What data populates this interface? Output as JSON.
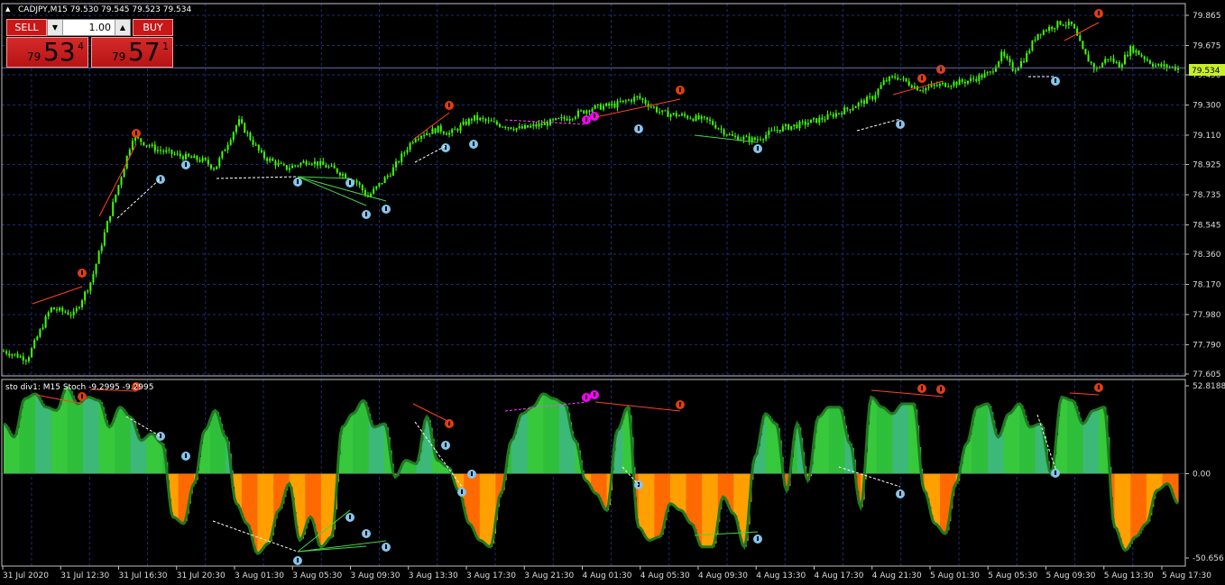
{
  "main_header": "CADJPY,M15  79.530 79.545 79.523 79.534",
  "sub_header": "sto div1: M15 Stoch -9.2995 -9.2995",
  "trade_panel": {
    "sell_label": "SELL",
    "buy_label": "BUY",
    "lot": "1.00",
    "down_arrow": "▼",
    "up_arrow": "▲",
    "sell_small": "79",
    "sell_big": "53",
    "sell_sup": "4",
    "buy_small": "79",
    "buy_big": "57",
    "buy_sup": "1"
  },
  "current_price_label": "79.534",
  "colors": {
    "background": "#000000",
    "grid": "#1e2a78",
    "candles": "#40ff00",
    "axis_text": "#dcdcdc",
    "bull_marker": "#86c4ea",
    "bear_marker": "#e23c12",
    "hidden_div_marker": "#ff00ff",
    "osc_positive": "#37c83c",
    "osc_negative": "#ff8c00",
    "osc_line": "#1f7a1f",
    "current_price_bg": "#c8f028"
  },
  "chart_data": [
    {
      "type": "candlestick",
      "symbol": "CADJPY",
      "timeframe": "M15",
      "ylim": [
        77.605,
        79.865
      ],
      "y_ticks": [
        "79.865",
        "79.675",
        "79.490",
        "79.300",
        "79.110",
        "78.925",
        "78.735",
        "78.545",
        "78.360",
        "78.170",
        "77.980",
        "77.790",
        "77.605"
      ],
      "current_price": 79.534,
      "x_ticks": [
        "31 Jul 2020",
        "31 Jul 12:30",
        "31 Jul 16:30",
        "31 Jul 20:30",
        "3 Aug 01:30",
        "3 Aug 05:30",
        "3 Aug 09:30",
        "3 Aug 13:30",
        "3 Aug 17:30",
        "3 Aug 21:30",
        "4 Aug 01:30",
        "4 Aug 05:30",
        "4 Aug 09:30",
        "4 Aug 13:30",
        "4 Aug 17:30",
        "4 Aug 21:30",
        "5 Aug 01:30",
        "5 Aug 05:30",
        "5 Aug 09:30",
        "5 Aug 13:30",
        "5 Aug 17:30"
      ],
      "price_path": [
        [
          0,
          77.75
        ],
        [
          0.02,
          77.7
        ],
        [
          0.04,
          78.02
        ],
        [
          0.06,
          77.98
        ],
        [
          0.075,
          78.2
        ],
        [
          0.09,
          78.6
        ],
        [
          0.11,
          79.1
        ],
        [
          0.13,
          79.02
        ],
        [
          0.15,
          78.98
        ],
        [
          0.17,
          78.95
        ],
        [
          0.18,
          78.9
        ],
        [
          0.2,
          79.2
        ],
        [
          0.22,
          78.98
        ],
        [
          0.24,
          78.9
        ],
        [
          0.26,
          78.95
        ],
        [
          0.28,
          78.9
        ],
        [
          0.3,
          78.82
        ],
        [
          0.31,
          78.72
        ],
        [
          0.33,
          78.88
        ],
        [
          0.35,
          79.1
        ],
        [
          0.37,
          79.15
        ],
        [
          0.38,
          79.12
        ],
        [
          0.4,
          79.22
        ],
        [
          0.42,
          79.18
        ],
        [
          0.44,
          79.15
        ],
        [
          0.46,
          79.18
        ],
        [
          0.48,
          79.22
        ],
        [
          0.5,
          79.28
        ],
        [
          0.52,
          79.3
        ],
        [
          0.54,
          79.35
        ],
        [
          0.56,
          79.25
        ],
        [
          0.58,
          79.23
        ],
        [
          0.6,
          79.2
        ],
        [
          0.62,
          79.1
        ],
        [
          0.64,
          79.08
        ],
        [
          0.66,
          79.15
        ],
        [
          0.68,
          79.18
        ],
        [
          0.7,
          79.22
        ],
        [
          0.72,
          79.28
        ],
        [
          0.74,
          79.35
        ],
        [
          0.75,
          79.45
        ],
        [
          0.76,
          79.48
        ],
        [
          0.78,
          79.4
        ],
        [
          0.8,
          79.43
        ],
        [
          0.82,
          79.45
        ],
        [
          0.84,
          79.5
        ],
        [
          0.85,
          79.62
        ],
        [
          0.86,
          79.52
        ],
        [
          0.87,
          79.6
        ],
        [
          0.88,
          79.75
        ],
        [
          0.9,
          79.82
        ],
        [
          0.91,
          79.8
        ],
        [
          0.92,
          79.62
        ],
        [
          0.93,
          79.52
        ],
        [
          0.94,
          79.6
        ],
        [
          0.95,
          79.55
        ],
        [
          0.96,
          79.66
        ],
        [
          0.98,
          79.55
        ],
        [
          1,
          79.534
        ]
      ],
      "bull_signals": [
        "31 Jul 16:30",
        "31 Jul 20:30",
        "3 Aug 05:30",
        "3 Aug 07:30",
        "3 Aug 09:30",
        "3 Aug 10:00",
        "3 Aug 16:30",
        "3 Aug 17:00",
        "4 Aug 05:30",
        "4 Aug 11:30",
        "4 Aug 23:00",
        "5 Aug 10:30"
      ],
      "bear_signals": [
        "31 Jul 12:00",
        "31 Jul 16:00",
        "3 Aug 15:00",
        "4 Aug 07:30",
        "4 Aug 23:00",
        "5 Aug 00:30",
        "5 Aug 13:00"
      ]
    },
    {
      "type": "area",
      "name": "sto div1: M15 Stoch",
      "value": -9.2995,
      "ylim": [
        -50.656,
        52.8188
      ],
      "y_ticks": [
        "52.8188",
        "0.00",
        "-50.656"
      ],
      "values": [
        30,
        22,
        45,
        48,
        40,
        38,
        52,
        42,
        46,
        44,
        28,
        40,
        34,
        20,
        24,
        18,
        -26,
        -30,
        -6,
        26,
        38,
        22,
        -18,
        -30,
        -48,
        -42,
        -22,
        -6,
        -40,
        -26,
        -44,
        -38,
        28,
        36,
        44,
        28,
        30,
        -2,
        8,
        6,
        34,
        8,
        4,
        -10,
        -30,
        -40,
        -44,
        -12,
        20,
        36,
        40,
        48,
        45,
        42,
        20,
        -4,
        -12,
        -22,
        26,
        40,
        -32,
        -40,
        -38,
        -18,
        -22,
        -30,
        -44,
        -44,
        -14,
        -24,
        -44,
        10,
        36,
        30,
        -10,
        30,
        -4,
        34,
        40,
        40,
        18,
        -20,
        46,
        40,
        36,
        42,
        42,
        -10,
        -30,
        -36,
        -6,
        18,
        40,
        42,
        22,
        36,
        42,
        28,
        30,
        0,
        46,
        44,
        30,
        38,
        40,
        -32,
        -46,
        -38,
        -30,
        -10,
        -6,
        -18
      ]
    }
  ]
}
